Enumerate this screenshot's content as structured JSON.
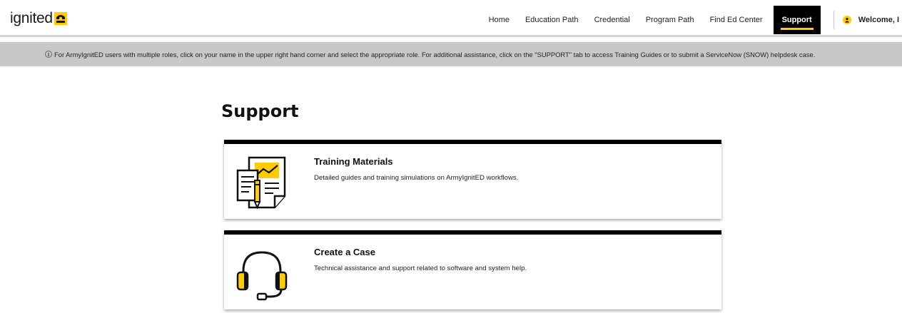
{
  "header": {
    "logo_text": "ignited",
    "nav": [
      "Home",
      "Education Path",
      "Credential",
      "Program Path",
      "Find Ed Center",
      "Support"
    ],
    "active_nav": "Support",
    "welcome": "Welcome, I"
  },
  "info_banner": {
    "text": "For ArmyIgnitED users with multiple roles, click on your name in the upper right hand corner and select the appropriate role. For additional assistance, click on the \"SUPPORT\" tab to access Training Guides or to submit a ServiceNow (SNOW) helpdesk case."
  },
  "page": {
    "title": "Support"
  },
  "cards": [
    {
      "title": "Training Materials",
      "description": "Detailed guides and training simulations on ArmyIgnitED workflows.",
      "icon": "training-document-icon"
    },
    {
      "title": "Create a Case",
      "description": "Technical assistance and support related to software and system help.",
      "icon": "headset-icon"
    }
  ],
  "colors": {
    "accent": "#ffcc01",
    "nav_active_bg": "#000000",
    "banner_bg": "#c8c8c8"
  }
}
